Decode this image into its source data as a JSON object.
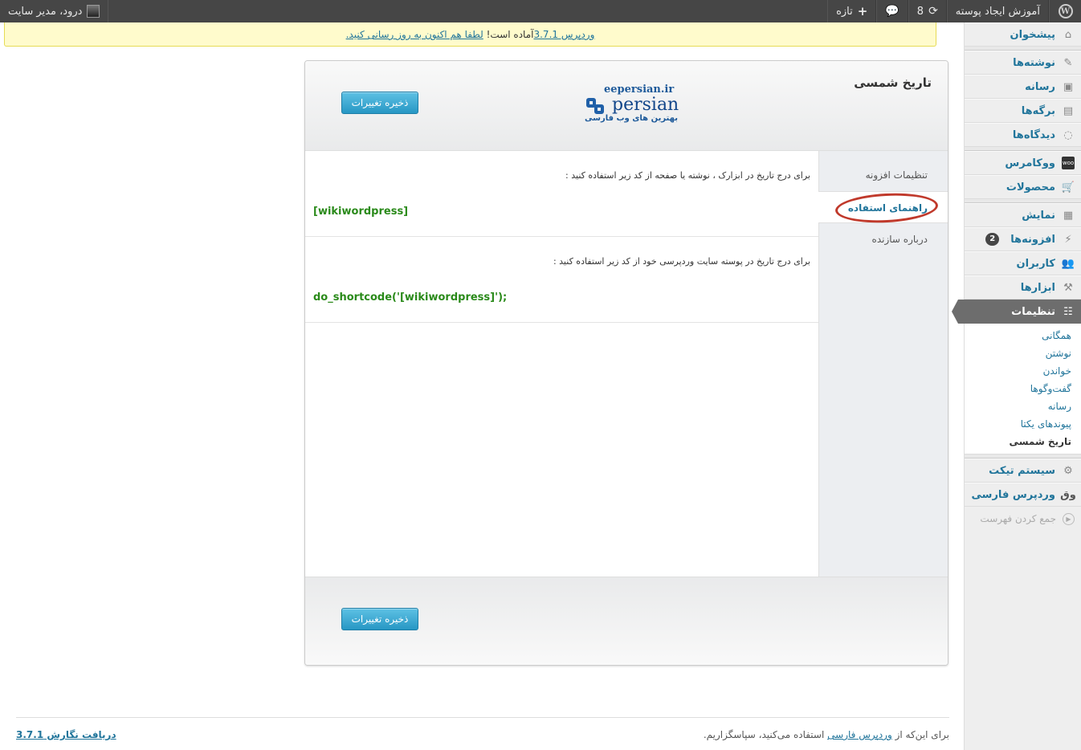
{
  "adminbar": {
    "wp_logo": "W",
    "site_name": "آموزش ایجاد پوسته",
    "updates_count": "8",
    "new_label": "تازه",
    "greeting": "درود، مدیر سایت"
  },
  "nag": {
    "link1": "وردپرس 3.7.1",
    "middle": "آماده است!",
    "link2": "لطفا هم اکنون به روز رسانی کنید."
  },
  "menu": {
    "dashboard": "پیشخوان",
    "posts": "نوشته‌ها",
    "media": "رسانه",
    "pages": "برگه‌ها",
    "comments": "دیدگاه‌ها",
    "woocommerce": "ووکامرس",
    "products": "محصولات",
    "appearance": "نمایش",
    "plugins": "افزونه‌ها",
    "plugins_badge": "2",
    "users": "کاربران",
    "tools": "ابزارها",
    "settings": "تنظیمات",
    "settings_sub": [
      "همگانی",
      "نوشتن",
      "خواندن",
      "گفت‌وگوها",
      "رسانه",
      "پیوندهای یکتا",
      "تاریخ شمسی"
    ],
    "ticket": "سیستم تیکت",
    "wpfarsi": "وردپرس فارسی",
    "collapse": "جمع کردن فهرست"
  },
  "panel": {
    "title": "تاریخ شمسی",
    "save_label": "ذخیره تغییرات",
    "logo_site": "eepersian.ir",
    "logo_word": "persian",
    "logo_tagline": "بهترین های وب فارسی",
    "nav": [
      "تنظیمات افزونه",
      "راهنمای استفاده",
      "درباره سازنده"
    ],
    "sections": [
      {
        "desc": "برای درج تاریخ در ابزارک ، نوشته یا صفحه از کد زیر استفاده کنید :",
        "code": "[wikiwordpress]"
      },
      {
        "desc": "برای درج تاریخ در پوسته سایت وردپرسی خود از کد زیر استفاده کنید :",
        "code": "do_shortcode('[wikiwordpress]');"
      }
    ]
  },
  "footer": {
    "thanks_pre": "برای این‌که از",
    "thanks_link": "وردپرس فارسی",
    "thanks_post": "استفاده می‌کنید، سپاسگزاریم.",
    "version": "دریافت نگارش 3.7.1"
  },
  "colors": {
    "accent": "#21759b",
    "button": "#2797c4",
    "highlight_ring": "#c0392b",
    "code": "#2a8a1a"
  }
}
